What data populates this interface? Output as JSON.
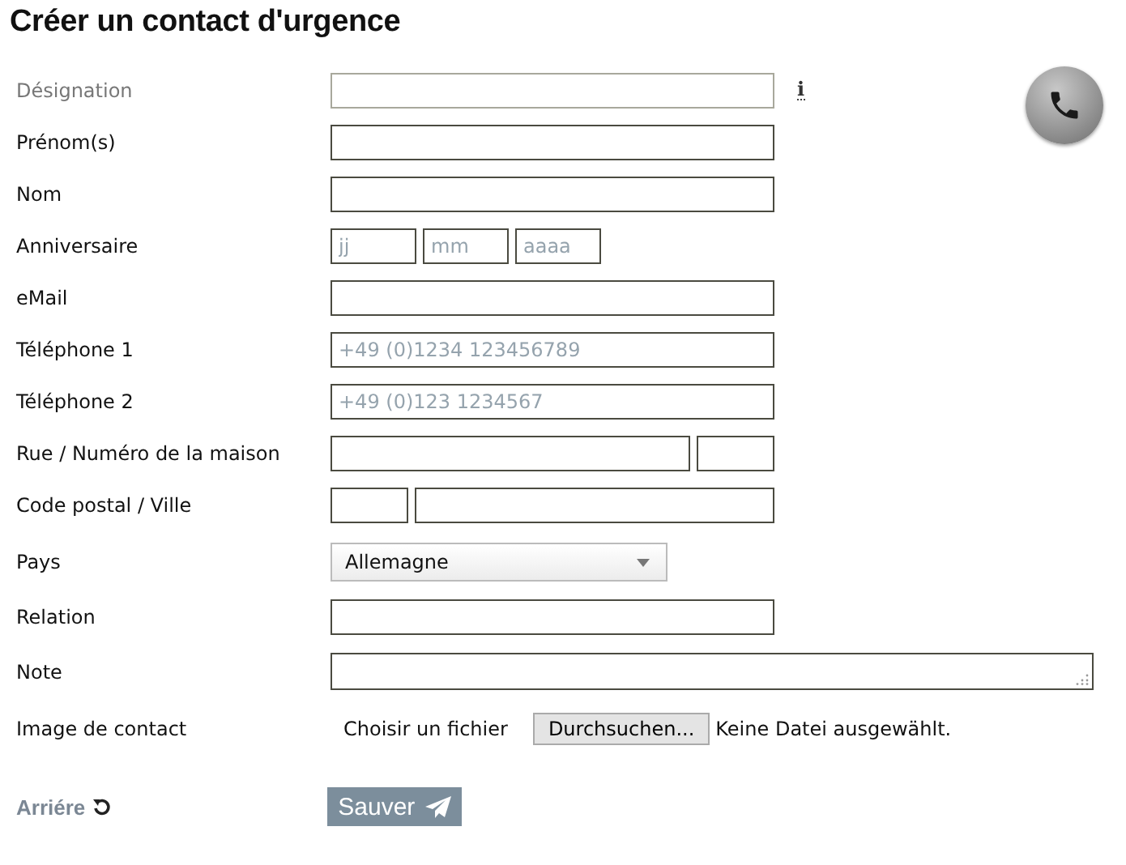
{
  "title": "Créer un contact d'urgence",
  "fields": [
    {
      "kind": "text",
      "label": "Désignation",
      "muted": true,
      "info": "i"
    },
    {
      "kind": "text",
      "label": "Prénom(s)",
      "muted": false
    },
    {
      "kind": "text",
      "label": "Nom",
      "muted": false
    },
    {
      "kind": "date",
      "label": "Anniversaire",
      "muted": false,
      "placeholders": [
        "jj",
        "mm",
        "aaaa"
      ]
    },
    {
      "kind": "text",
      "label": "eMail",
      "muted": false
    },
    {
      "kind": "text",
      "label": "Téléphone 1",
      "muted": false,
      "placeholder": "+49 (0)1234 123456789"
    },
    {
      "kind": "text",
      "label": "Téléphone 2",
      "muted": false,
      "placeholder": "+49 (0)123 1234567"
    },
    {
      "kind": "wide_small",
      "label": "Rue / Numéro de la maison",
      "muted": false
    },
    {
      "kind": "small_wide",
      "label": "Code postal / Ville",
      "muted": false
    },
    {
      "kind": "select",
      "label": "Pays",
      "muted": false,
      "value": "Allemagne"
    },
    {
      "kind": "text",
      "label": "Relation",
      "muted": false
    },
    {
      "kind": "textarea",
      "label": "Note",
      "muted": false
    },
    {
      "kind": "file",
      "label": "Image de contact",
      "muted": false,
      "file_label": "Choisir un fichier",
      "button": "Durchsuchen...",
      "status": "Keine Datei ausgewählt."
    }
  ],
  "back_link": "Arriére",
  "save_button": "Sauver"
}
